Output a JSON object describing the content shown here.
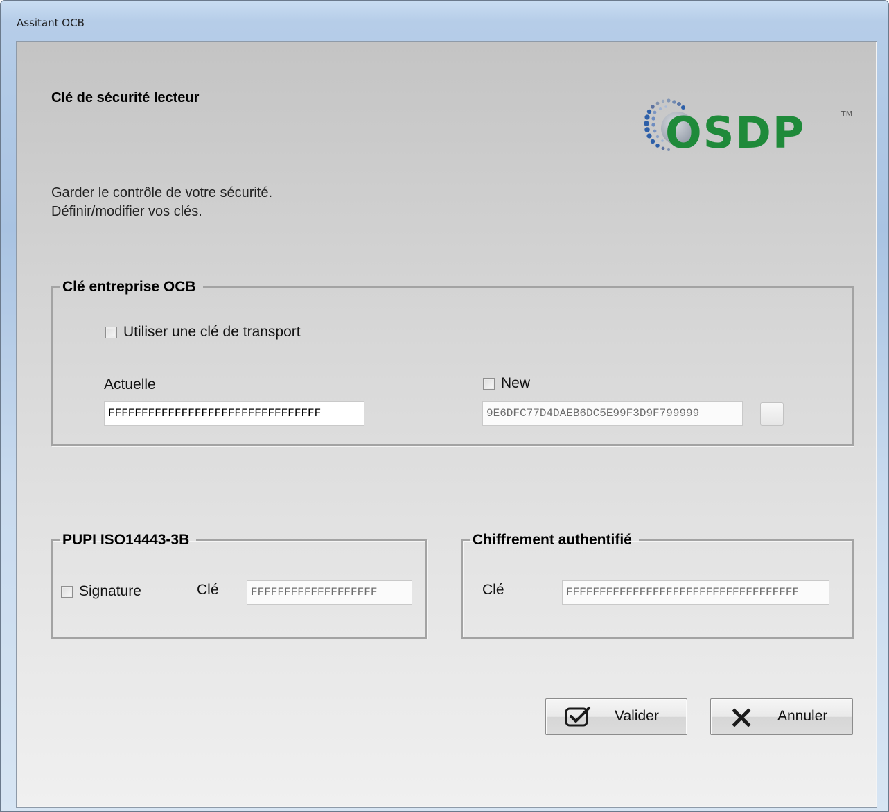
{
  "window": {
    "title": "Assitant OCB"
  },
  "header": {
    "title": "Clé de sécurité lecteur",
    "logo_text": "OSDP",
    "logo_tm": "TM",
    "description_line1": "Garder le contrôle de votre sécurité.",
    "description_line2": "Définir/modifier vos clés."
  },
  "ocb_group": {
    "legend": "Clé entreprise OCB",
    "transport_checkbox_label": "Utiliser une clé de transport",
    "current_label": "Actuelle",
    "current_value": "FFFFFFFFFFFFFFFFFFFFFFFFFFFFFFFF",
    "new_checkbox_label": "New",
    "new_value": "9E6DFC77D4DAEB6DC5E99F3D9F799999"
  },
  "pupi_group": {
    "legend": "PUPI ISO14443-3B",
    "signature_label": "Signature",
    "key_label": "Clé",
    "key_value": "FFFFFFFFFFFFFFFFFFF"
  },
  "auth_group": {
    "legend": "Chiffrement authentifié",
    "key_label": "Clé",
    "key_value": "FFFFFFFFFFFFFFFFFFFFFFFFFFFFFFFFFFF"
  },
  "buttons": {
    "validate": "Valider",
    "cancel": "Annuler"
  },
  "colors": {
    "logo_green": "#1f8a3a",
    "logo_blue": "#2d5fa8"
  },
  "icons": {
    "validate": "check-icon",
    "cancel": "close-icon"
  }
}
